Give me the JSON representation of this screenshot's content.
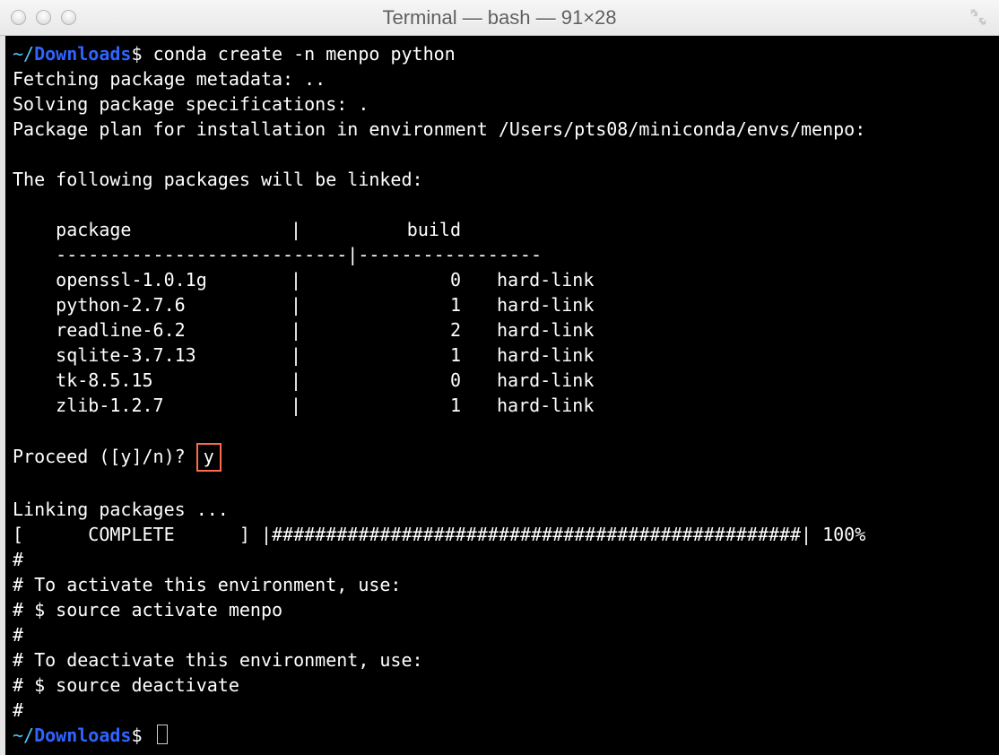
{
  "window": {
    "title": "Terminal — bash — 91×28"
  },
  "prompt": {
    "home": "~/",
    "dir": "Downloads",
    "sep": "$ "
  },
  "command1": "conda create -n menpo python",
  "lines": {
    "fetch": "Fetching package metadata: ..",
    "solving": "Solving package specifications: .",
    "plan": "Package plan for installation in environment /Users/pts08/miniconda/envs/menpo:",
    "following": "The following packages will be linked:",
    "hdr_pkg": "    package",
    "hdr_pipe": "|",
    "hdr_build": "build",
    "rule": "    ---------------------------|-----------------",
    "proceed": "Proceed ([y]/n)? ",
    "proceed_answer": "y",
    "linking": "Linking packages ...",
    "progress": "[      COMPLETE      ] |#################################################| 100%",
    "hash": "#",
    "activate_hdr": "# To activate this environment, use:",
    "activate_cmd": "# $ source activate menpo",
    "deactivate_hdr": "# To deactivate this environment, use:",
    "deactivate_cmd": "# $ source deactivate"
  },
  "packages": [
    {
      "name": "openssl-1.0.1g",
      "build": "0",
      "link": "hard-link"
    },
    {
      "name": "python-2.7.6",
      "build": "1",
      "link": "hard-link"
    },
    {
      "name": "readline-6.2",
      "build": "2",
      "link": "hard-link"
    },
    {
      "name": "sqlite-3.7.13",
      "build": "1",
      "link": "hard-link"
    },
    {
      "name": "tk-8.5.15",
      "build": "0",
      "link": "hard-link"
    },
    {
      "name": "zlib-1.2.7",
      "build": "1",
      "link": "hard-link"
    }
  ]
}
